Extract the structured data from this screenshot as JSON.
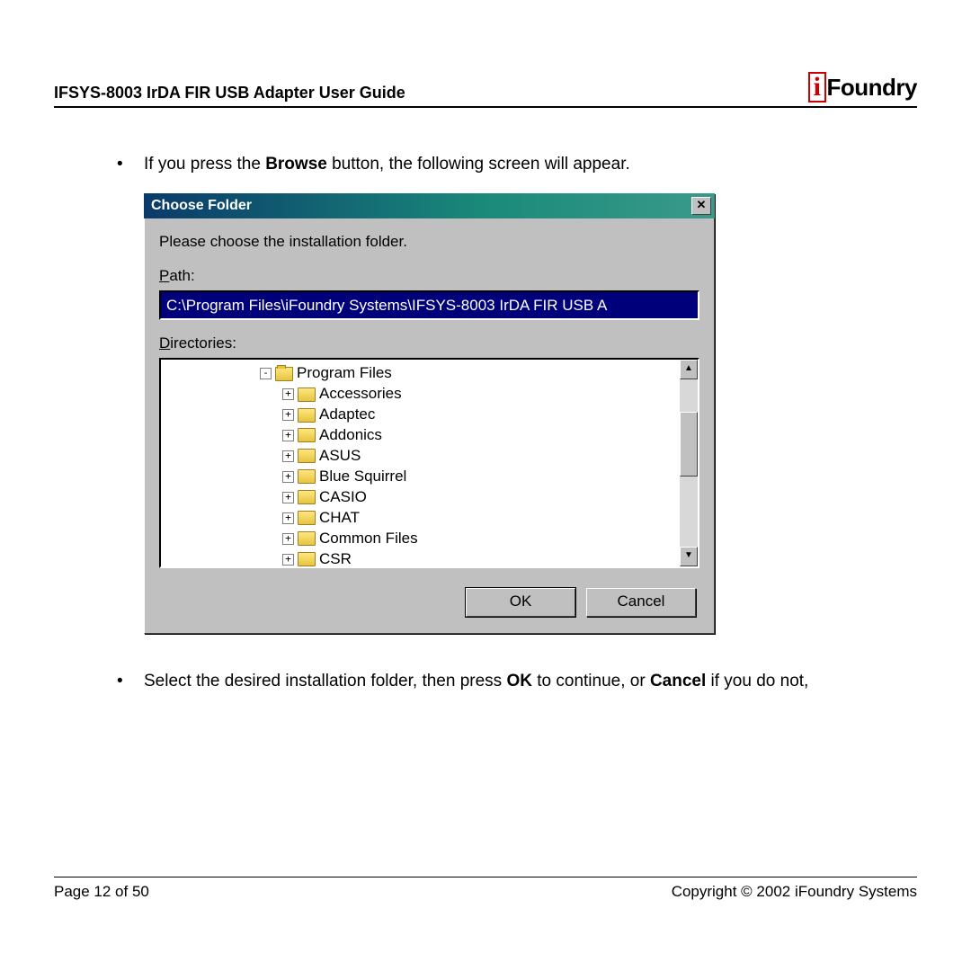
{
  "header": {
    "title": "IFSYS-8003 IrDA FIR USB Adapter User Guide",
    "logo_prefix": "i",
    "logo_rest": "Foundry"
  },
  "bullets": {
    "b1_pre": "If you press the ",
    "b1_bold": "Browse",
    "b1_post": " button, the following screen will appear.",
    "b2_pre": "Select the desired installation folder, then press ",
    "b2_bold1": "OK",
    "b2_mid": " to continue, or ",
    "b2_bold2": "Cancel",
    "b2_post": " if you do not,"
  },
  "dialog": {
    "title": "Choose Folder",
    "instruction": "Please choose the installation folder.",
    "path_label_u": "P",
    "path_label_rest": "ath:",
    "path_value": "C:\\Program Files\\iFoundry Systems\\IFSYS-8003 IrDA FIR USB A",
    "dir_label_u": "D",
    "dir_label_rest": "irectories:",
    "tree": {
      "root": "Program Files",
      "children": [
        "Accessories",
        "Adaptec",
        "Addonics",
        "ASUS",
        "Blue Squirrel",
        "CASIO",
        "CHAT",
        "Common Files",
        "CSR"
      ]
    },
    "ok": "OK",
    "cancel": "Cancel"
  },
  "footer": {
    "page": "Page 12 of 50",
    "copyright": "Copyright © 2002 iFoundry Systems"
  }
}
